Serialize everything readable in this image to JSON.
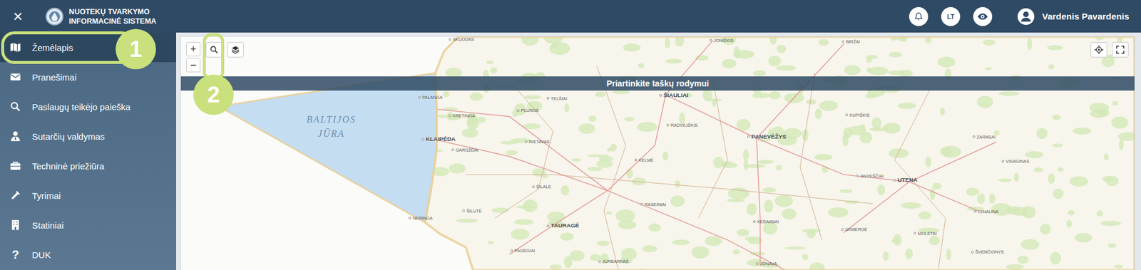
{
  "header": {
    "close": "×",
    "title_lines": [
      "NUOTEKŲ TVARKYMO",
      "INFORMACINĖ SISTEMA"
    ],
    "language": "LT",
    "user": "Vardenis Pavardenis"
  },
  "sidebar": {
    "items": [
      {
        "label": "Žemėlapis",
        "selected": true
      },
      {
        "label": "Pranešimai",
        "selected": false
      },
      {
        "label": "Paslaugų teikėjo paieška",
        "selected": false
      },
      {
        "label": "Sutarčių valdymas",
        "selected": false
      },
      {
        "label": "Techninė priežiūra",
        "selected": false
      },
      {
        "label": "Tyrimai",
        "selected": false
      },
      {
        "label": "Statiniai",
        "selected": false
      },
      {
        "label": "DUK",
        "selected": false,
        "glyph": "?"
      }
    ]
  },
  "map": {
    "zoom_in": "+",
    "zoom_out": "−",
    "banner": "Priartinkite taškų rodymui",
    "sea_lines": [
      "BALTIJOS",
      "JŪRA"
    ],
    "labels": [
      {
        "text": "SKUODAS",
        "kind": "town"
      },
      {
        "text": "JONIŠKIS",
        "kind": "town"
      },
      {
        "text": "BIRŽAI",
        "kind": "town"
      },
      {
        "text": "PALANGA",
        "kind": "town"
      },
      {
        "text": "KRETINGA",
        "kind": "town"
      },
      {
        "text": "PLUNGĖ",
        "kind": "town"
      },
      {
        "text": "TELŠIAI",
        "kind": "town"
      },
      {
        "text": "ŠIAULIAI",
        "kind": "city"
      },
      {
        "text": "RADVILIŠKIS",
        "kind": "town"
      },
      {
        "text": "KUPIŠKIS",
        "kind": "town"
      },
      {
        "text": "PANEVĖŽYS",
        "kind": "city"
      },
      {
        "text": "KLAIPĖDA",
        "kind": "city"
      },
      {
        "text": "GARGŽDAI",
        "kind": "town"
      },
      {
        "text": "RIETAVAS",
        "kind": "town"
      },
      {
        "text": "KELMĖ",
        "kind": "town"
      },
      {
        "text": "ZARASAI",
        "kind": "town"
      },
      {
        "text": "VISAGINAS",
        "kind": "town"
      },
      {
        "text": "ANYKŠČIAI",
        "kind": "town"
      },
      {
        "text": "UTENA",
        "kind": "city"
      },
      {
        "text": "ŠILALĖ",
        "kind": "town"
      },
      {
        "text": "ŠILUTĖ",
        "kind": "town"
      },
      {
        "text": "RASEINIAI",
        "kind": "town"
      },
      {
        "text": "NERINGA",
        "kind": "town"
      },
      {
        "text": "TAURAGĖ",
        "kind": "city"
      },
      {
        "text": "KĖDAINIAI",
        "kind": "town"
      },
      {
        "text": "UKMERGĖ",
        "kind": "town"
      },
      {
        "text": "MOLĖTAI",
        "kind": "town"
      },
      {
        "text": "IGNALINA",
        "kind": "town"
      },
      {
        "text": "PAGĖGIAI",
        "kind": "town"
      },
      {
        "text": "ŠVENČIONYS",
        "kind": "town"
      },
      {
        "text": "JURBARKAS",
        "kind": "town"
      },
      {
        "text": "JONAVA",
        "kind": "town"
      }
    ]
  },
  "callouts": [
    {
      "number": "1"
    },
    {
      "number": "2"
    }
  ]
}
